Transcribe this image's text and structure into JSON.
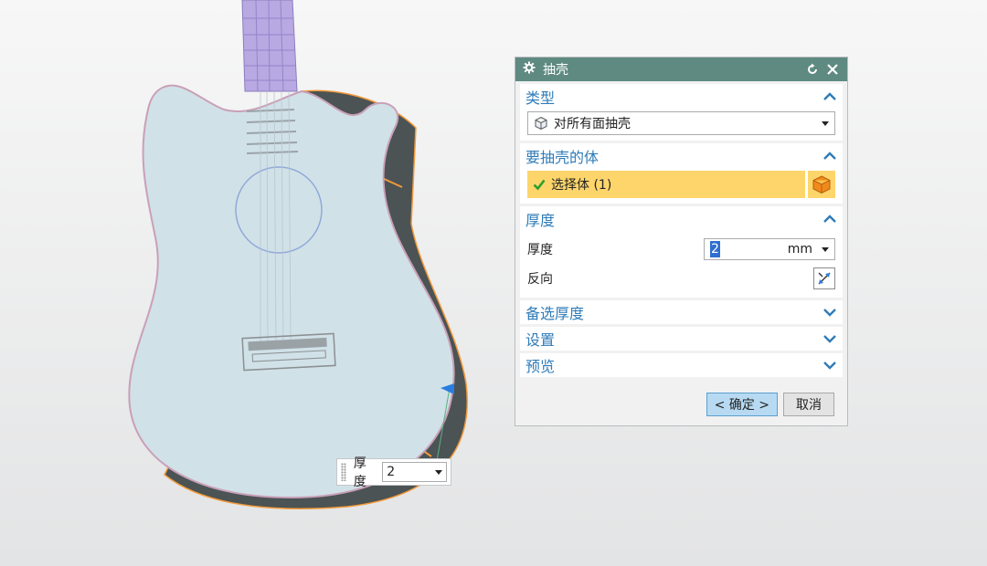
{
  "dialog": {
    "title": "抽壳",
    "icons": {
      "settings": "gear-icon",
      "reset": "reset-icon",
      "close": "close-icon"
    },
    "sections": {
      "type": {
        "title": "类型",
        "dropdown_value": "对所有面抽壳"
      },
      "body": {
        "title": "要抽壳的体",
        "selection_label": "选择体 (1)"
      },
      "thickness": {
        "title": "厚度",
        "thickness_label": "厚度",
        "thickness_value": "2",
        "unit": "mm",
        "reverse_label": "反向"
      },
      "alt_thickness": {
        "title": "备选厚度"
      },
      "settings": {
        "title": "设置"
      },
      "preview": {
        "title": "预览"
      }
    },
    "buttons": {
      "ok": "< 确定 >",
      "cancel": "取消"
    }
  },
  "floating": {
    "label": "厚度",
    "value": "2"
  },
  "colors": {
    "title_bar": "#5e8a81",
    "section_title": "#2f7cb8",
    "selection_highlight": "#fdd56b",
    "model_face": "#d1e1e8",
    "model_shell": "#4b5354",
    "edge_highlight": "#f39a3a",
    "neck": "#b9a9e2"
  }
}
